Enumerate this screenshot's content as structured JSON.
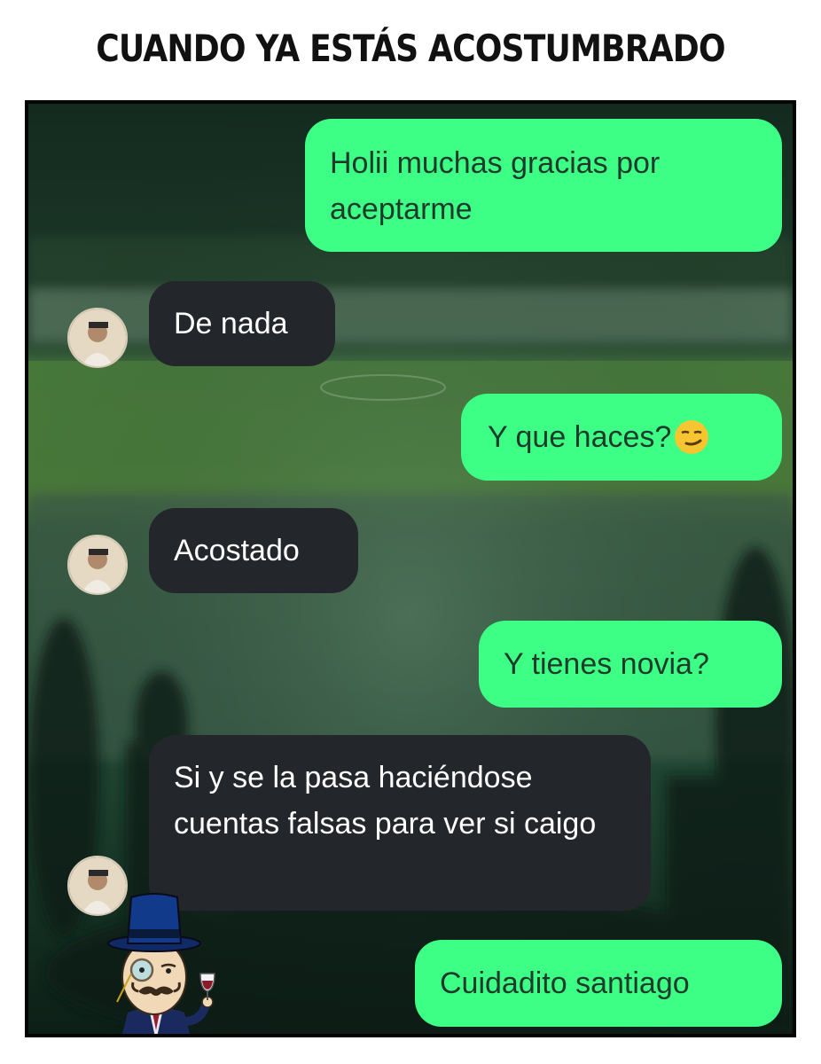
{
  "title": "CUANDO YA ESTÁS ACOSTUMBRADO",
  "colors": {
    "sent_bubble": "#3dff86",
    "received_bubble": "#23262a",
    "sent_text": "#1e3a2a",
    "received_text": "#ffffff"
  },
  "chat": {
    "messages": [
      {
        "from": "me",
        "text": "Holii muchas gracias por aceptarme"
      },
      {
        "from": "them",
        "text": "De nada"
      },
      {
        "from": "me",
        "text": "Y que haces?",
        "emoji": "smirking-face"
      },
      {
        "from": "them",
        "text": "Acostado"
      },
      {
        "from": "me",
        "text": "Y tienes novia?"
      },
      {
        "from": "them",
        "text": "Si y se la pasa haciéndose cuentas falsas para ver si caigo"
      },
      {
        "from": "me",
        "text": "Cuidadito santiago"
      }
    ]
  },
  "icons": {
    "avatar": "contact-avatar-icon",
    "sticker": "gentleman-rage-face-sticker"
  }
}
